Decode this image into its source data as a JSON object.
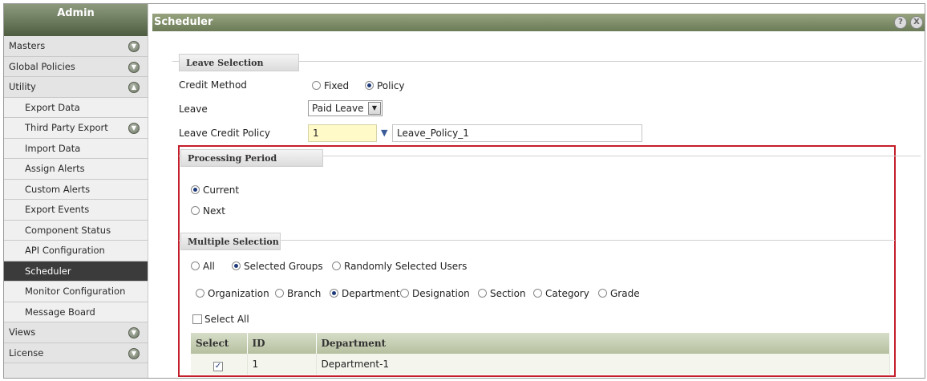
{
  "sidebar": {
    "header": "Admin",
    "items": [
      {
        "label": "Masters",
        "expandable": true,
        "expanded": false,
        "level": 0
      },
      {
        "label": "Global Policies",
        "expandable": true,
        "expanded": false,
        "level": 0
      },
      {
        "label": "Utility",
        "expandable": true,
        "expanded": true,
        "level": 0
      },
      {
        "label": "Export Data",
        "level": 1
      },
      {
        "label": "Third Party Export",
        "expandable": true,
        "expanded": false,
        "level": 1
      },
      {
        "label": "Import Data",
        "level": 1
      },
      {
        "label": "Assign Alerts",
        "level": 1
      },
      {
        "label": "Custom Alerts",
        "level": 1
      },
      {
        "label": "Export Events",
        "level": 1
      },
      {
        "label": "Component Status",
        "level": 1
      },
      {
        "label": "API Configuration",
        "level": 1
      },
      {
        "label": "Scheduler",
        "level": 1,
        "active": true
      },
      {
        "label": "Monitor Configuration",
        "level": 1
      },
      {
        "label": "Message Board",
        "level": 1
      },
      {
        "label": "Views",
        "expandable": true,
        "expanded": false,
        "level": 0
      },
      {
        "label": "License",
        "expandable": true,
        "expanded": false,
        "level": 0
      }
    ]
  },
  "panel": {
    "title": "Scheduler",
    "help_icon": "?",
    "close_icon": "X"
  },
  "leave_selection": {
    "heading": "Leave Selection",
    "credit_method_label": "Credit Method",
    "credit_method_options": [
      "Fixed",
      "Policy"
    ],
    "credit_method_selected": "Policy",
    "leave_label": "Leave",
    "leave_value": "Paid Leave",
    "policy_label": "Leave Credit Policy",
    "policy_id": "1",
    "policy_name": "Leave_Policy_1"
  },
  "processing_period": {
    "heading": "Processing Period",
    "options": [
      "Current",
      "Next"
    ],
    "selected": "Current"
  },
  "multiple_selection": {
    "heading": "Multiple Selection",
    "scope_options": [
      "All",
      "Selected Groups",
      "Randomly Selected Users"
    ],
    "scope_selected": "Selected Groups",
    "group_options": [
      "Organization",
      "Branch",
      "Department",
      "Designation",
      "Section",
      "Category",
      "Grade"
    ],
    "group_selected": "Department",
    "select_all_label": "Select All",
    "select_all_checked": false
  },
  "table": {
    "columns": [
      "Select",
      "ID",
      "Department"
    ],
    "rows": [
      {
        "checked": true,
        "id": "1",
        "name": "Department-1"
      }
    ]
  },
  "colors": {
    "highlight": "#c41e2a",
    "titlebar": "#7b8a62",
    "active_nav": "#3b3b3b"
  }
}
